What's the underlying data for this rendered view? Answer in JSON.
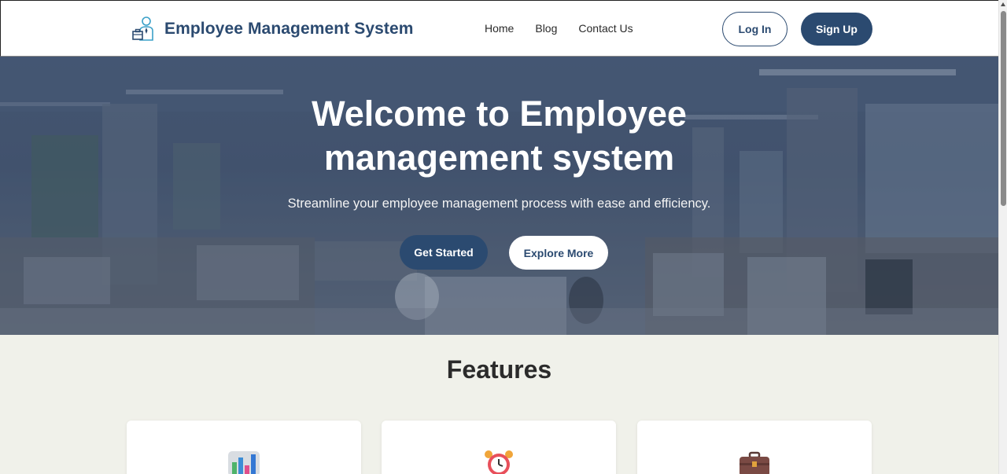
{
  "navbar": {
    "brand_title": "Employee Management System",
    "brand_icon": "employee-briefcase-icon",
    "links": [
      "Home",
      "Blog",
      "Contact Us"
    ],
    "login_label": "Log In",
    "signup_label": "Sign Up"
  },
  "hero": {
    "title_line1": "Welcome to Employee",
    "title_line2": "management system",
    "subtitle": "Streamline your employee management process with ease and efficiency.",
    "get_started_label": "Get Started",
    "explore_label": "Explore More"
  },
  "features": {
    "title": "Features",
    "cards": [
      {
        "icon": "bar-chart-icon"
      },
      {
        "icon": "alarm-clock-icon"
      },
      {
        "icon": "briefcase-icon"
      }
    ]
  },
  "colors": {
    "primary": "#2b4a70",
    "page_bg": "#f0f1ea"
  }
}
